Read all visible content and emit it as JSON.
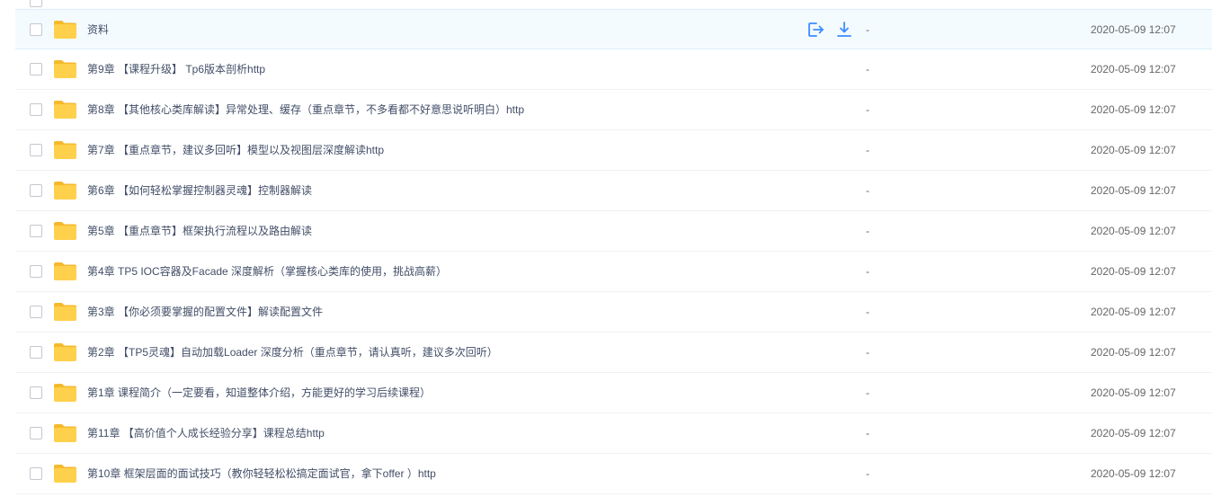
{
  "colors": {
    "folder": "#ffd04b",
    "folder_dark": "#f5b92b",
    "action_blue": "#3b8cff",
    "selected_bg": "#f4fbff"
  },
  "files": [
    {
      "name": "资料",
      "size": "-",
      "date": "2020-05-09 12:07",
      "selected": true,
      "icon": "folder-icon"
    },
    {
      "name": "第9章 【课程升级】 Tp6版本剖析http",
      "size": "-",
      "date": "2020-05-09 12:07",
      "icon": "folder-icon"
    },
    {
      "name": "第8章 【其他核心类库解读】异常处理、缓存（重点章节，不多看都不好意思说听明白）http",
      "size": "-",
      "date": "2020-05-09 12:07",
      "icon": "folder-icon"
    },
    {
      "name": "第7章 【重点章节，建议多回听】模型以及视图层深度解读http",
      "size": "-",
      "date": "2020-05-09 12:07",
      "icon": "folder-icon"
    },
    {
      "name": "第6章 【如何轻松掌握控制器灵魂】控制器解读",
      "size": "-",
      "date": "2020-05-09 12:07",
      "icon": "folder-icon"
    },
    {
      "name": "第5章 【重点章节】框架执行流程以及路由解读",
      "size": "-",
      "date": "2020-05-09 12:07",
      "icon": "folder-icon"
    },
    {
      "name": "第4章 TP5 IOC容器及Facade 深度解析（掌握核心类库的使用，挑战高薪）",
      "size": "-",
      "date": "2020-05-09 12:07",
      "icon": "folder-icon"
    },
    {
      "name": "第3章 【你必须要掌握的配置文件】解读配置文件",
      "size": "-",
      "date": "2020-05-09 12:07",
      "icon": "folder-icon"
    },
    {
      "name": "第2章 【TP5灵魂】自动加载Loader 深度分析（重点章节，请认真听，建议多次回听）",
      "size": "-",
      "date": "2020-05-09 12:07",
      "icon": "folder-icon"
    },
    {
      "name": "第1章 课程简介（一定要看，知道整体介绍，方能更好的学习后续课程）",
      "size": "-",
      "date": "2020-05-09 12:07",
      "icon": "folder-icon"
    },
    {
      "name": "第11章 【高价值个人成长经验分享】课程总结http",
      "size": "-",
      "date": "2020-05-09 12:07",
      "icon": "folder-icon"
    },
    {
      "name": "第10章 框架层面的面试技巧（教你轻轻松松搞定面试官，拿下offer ）http",
      "size": "-",
      "date": "2020-05-09 12:07",
      "icon": "folder-icon"
    }
  ],
  "row_actions": [
    {
      "icon": "share-icon"
    },
    {
      "icon": "download-icon"
    }
  ]
}
